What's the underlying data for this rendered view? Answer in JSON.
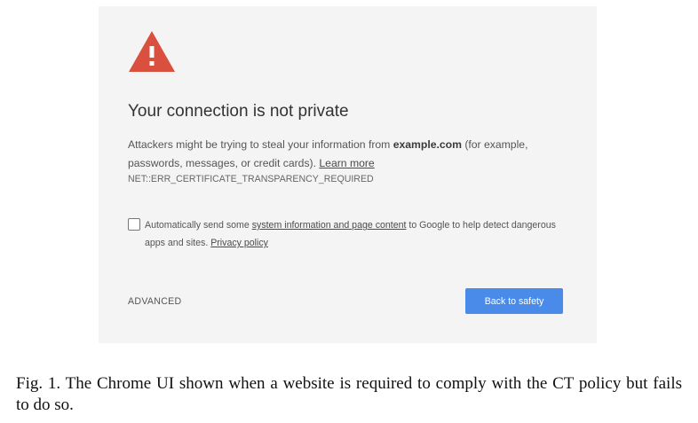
{
  "icon": "warning-triangle-icon",
  "colors": {
    "warning_icon": "#d9503f",
    "panel_background": "#f4f4f4",
    "primary_button": "#4a8ae8"
  },
  "interstitial": {
    "title": "Your connection is not private",
    "description": {
      "before_domain": "Attackers might be trying to steal your information from ",
      "domain": "example.com",
      "after_domain": " (for example, passwords, messages, or credit cards). ",
      "learn_more": "Learn more"
    },
    "error_code": "NET::ERR_CERTIFICATE_TRANSPARENCY_REQUIRED",
    "consent": {
      "checked": false,
      "before_link": "Automatically send some ",
      "link": "system information and page content",
      "after_link": " to Google to help detect dangerous apps and sites. ",
      "privacy_link": "Privacy policy"
    },
    "advanced_label": "ADVANCED",
    "back_button_label": "Back to safety"
  },
  "caption": "Fig. 1.  The Chrome UI shown when a website is required to comply with the CT policy but fails to do so."
}
